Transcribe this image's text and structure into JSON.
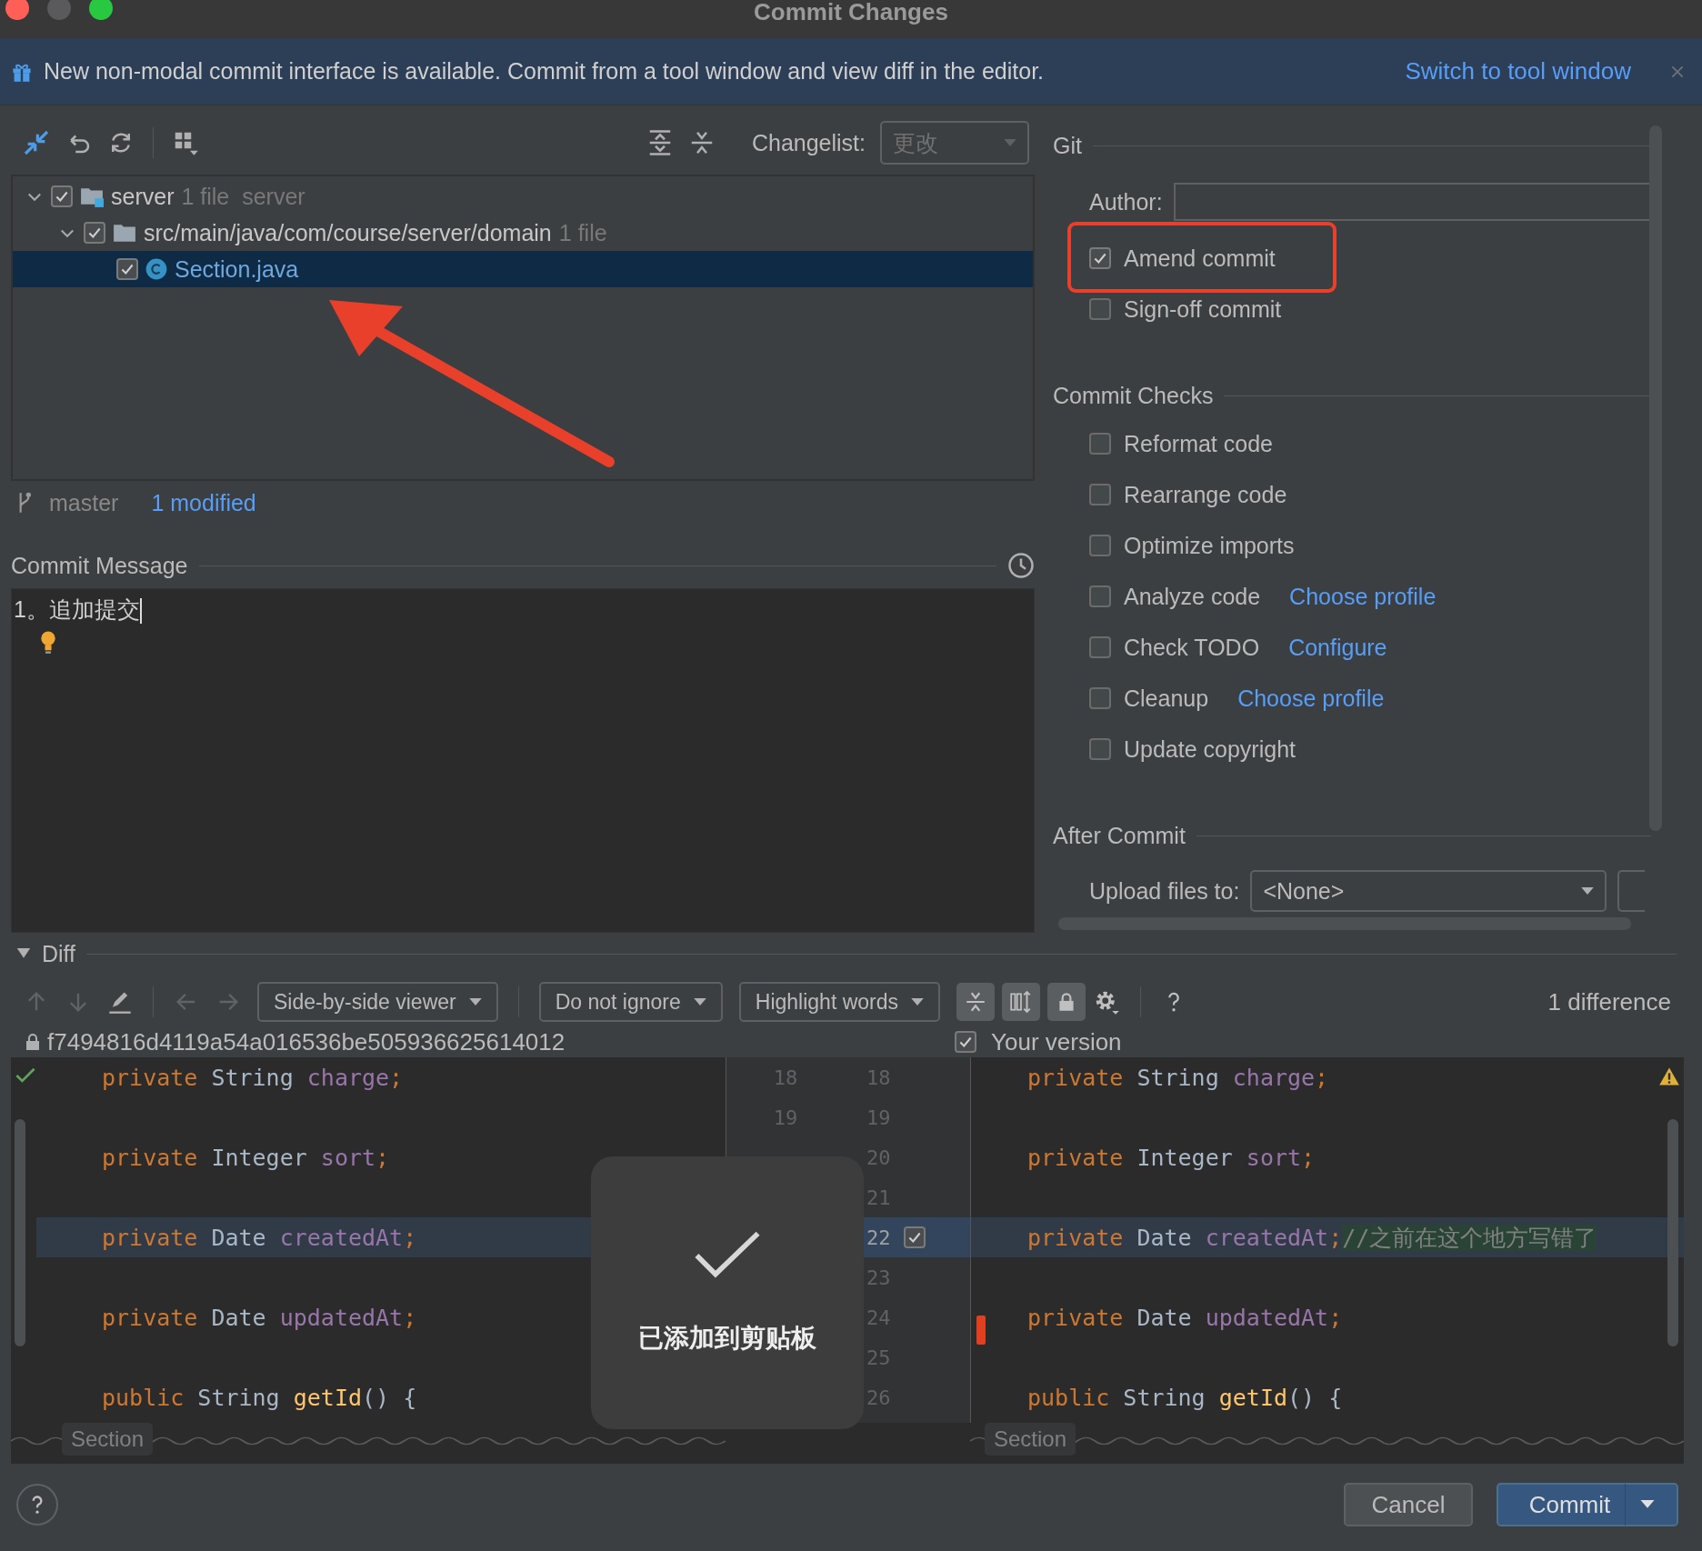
{
  "window": {
    "title": "Commit Changes"
  },
  "banner": {
    "text": "New non-modal commit interface is available. Commit from a tool window and view diff in the editor.",
    "link": "Switch to tool window"
  },
  "changes": {
    "changelist_label": "Changelist:",
    "changelist_value": "更改",
    "tree": [
      {
        "name": "server",
        "detail": "1 file  server",
        "kind": "module",
        "checked": true,
        "expanded": true,
        "selected": false,
        "children": [
          {
            "name": "src/main/java/com/course/server/domain",
            "detail": "1 file",
            "kind": "folder",
            "checked": true,
            "expanded": true,
            "selected": false,
            "children": [
              {
                "name": "Section.java",
                "kind": "class",
                "checked": true,
                "selected": true
              }
            ]
          }
        ]
      }
    ],
    "branch": "master",
    "modified": "1 modified"
  },
  "commit_message": {
    "label": "Commit Message",
    "value": "1。追加提交"
  },
  "git": {
    "title": "Git",
    "author_label": "Author:",
    "options": [
      {
        "label": "Amend commit",
        "checked": true
      },
      {
        "label": "Sign-off commit",
        "checked": false
      }
    ]
  },
  "commit_checks": {
    "title": "Commit Checks",
    "items": [
      {
        "label": "Reformat code",
        "checked": false
      },
      {
        "label": "Rearrange code",
        "checked": false
      },
      {
        "label": "Optimize imports",
        "checked": false
      },
      {
        "label": "Analyze code",
        "checked": false,
        "link": "Choose profile"
      },
      {
        "label": "Check TODO",
        "checked": false,
        "link": "Configure"
      },
      {
        "label": "Cleanup",
        "checked": false,
        "link": "Choose profile"
      },
      {
        "label": "Update copyright",
        "checked": false
      }
    ]
  },
  "after_commit": {
    "title": "After Commit",
    "upload_label": "Upload files to:",
    "upload_value": "<None>"
  },
  "diff": {
    "title": "Diff",
    "expanded": true,
    "viewer": "Side-by-side viewer",
    "ignore": "Do not ignore",
    "highlight": "Highlight words",
    "count": "1 difference",
    "left_title": "f7494816d4119a54a016536be505936625614012",
    "right_title": "Your version",
    "right_checked": true,
    "rows": [
      {
        "left_num": "18",
        "right_num": "18",
        "left": [
          {
            "text": "private",
            "kind": "keyword"
          },
          {
            "text": " String ",
            "kind": "plain"
          },
          {
            "text": "charge",
            "kind": "field"
          },
          {
            "text": ";",
            "kind": "keyword"
          }
        ],
        "right": [
          {
            "text": "private",
            "kind": "keyword"
          },
          {
            "text": " String ",
            "kind": "plain"
          },
          {
            "text": "charge",
            "kind": "field"
          },
          {
            "text": ";",
            "kind": "keyword"
          }
        ]
      },
      {
        "left_num": "19",
        "right_num": "19"
      },
      {
        "right_num": "20",
        "left": [
          {
            "text": "private",
            "kind": "keyword"
          },
          {
            "text": " Integer ",
            "kind": "plain"
          },
          {
            "text": "sort",
            "kind": "field"
          },
          {
            "text": ";",
            "kind": "keyword"
          }
        ],
        "right": [
          {
            "text": "private",
            "kind": "keyword"
          },
          {
            "text": " Integer ",
            "kind": "plain"
          },
          {
            "text": "sort",
            "kind": "field"
          },
          {
            "text": ";",
            "kind": "keyword"
          }
        ]
      },
      {
        "right_num": "21"
      },
      {
        "right_num": "22",
        "included": true,
        "left": [
          {
            "text": "private",
            "kind": "keyword"
          },
          {
            "text": " Date ",
            "kind": "plain"
          },
          {
            "text": "createdAt",
            "kind": "field"
          },
          {
            "text": ";",
            "kind": "keyword"
          }
        ],
        "right": [
          {
            "text": "private",
            "kind": "keyword"
          },
          {
            "text": " Date ",
            "kind": "plain"
          },
          {
            "text": "createdAt",
            "kind": "field"
          },
          {
            "text": ";",
            "kind": "keyword"
          },
          {
            "text": "//之前在这个地方写错了",
            "kind": "inserted"
          }
        ]
      },
      {
        "right_num": "23"
      },
      {
        "right_num": "24",
        "left": [
          {
            "text": "private",
            "kind": "keyword"
          },
          {
            "text": " Date ",
            "kind": "plain"
          },
          {
            "text": "updatedAt",
            "kind": "field"
          },
          {
            "text": ";",
            "kind": "keyword"
          }
        ],
        "right": [
          {
            "text": "private",
            "kind": "keyword"
          },
          {
            "text": " Date ",
            "kind": "plain"
          },
          {
            "text": "updatedAt",
            "kind": "field"
          },
          {
            "text": ";",
            "kind": "keyword"
          }
        ]
      },
      {
        "right_num": "25"
      },
      {
        "right_num": "26",
        "left": [
          {
            "text": "public",
            "kind": "keyword"
          },
          {
            "text": " String ",
            "kind": "plain"
          },
          {
            "text": "getId",
            "kind": "method"
          },
          {
            "text": "() {",
            "kind": "plain"
          }
        ],
        "right": [
          {
            "text": "public",
            "kind": "keyword"
          },
          {
            "text": " String ",
            "kind": "plain"
          },
          {
            "text": "getId",
            "kind": "method"
          },
          {
            "text": "() {",
            "kind": "plain"
          }
        ]
      }
    ],
    "fold_labels": [
      "Section",
      "Section"
    ]
  },
  "toast": {
    "text": "已添加到剪贴板"
  },
  "buttons": [
    {
      "label": "Cancel",
      "kind": "secondary"
    },
    {
      "label": "Commit",
      "kind": "primary"
    }
  ]
}
